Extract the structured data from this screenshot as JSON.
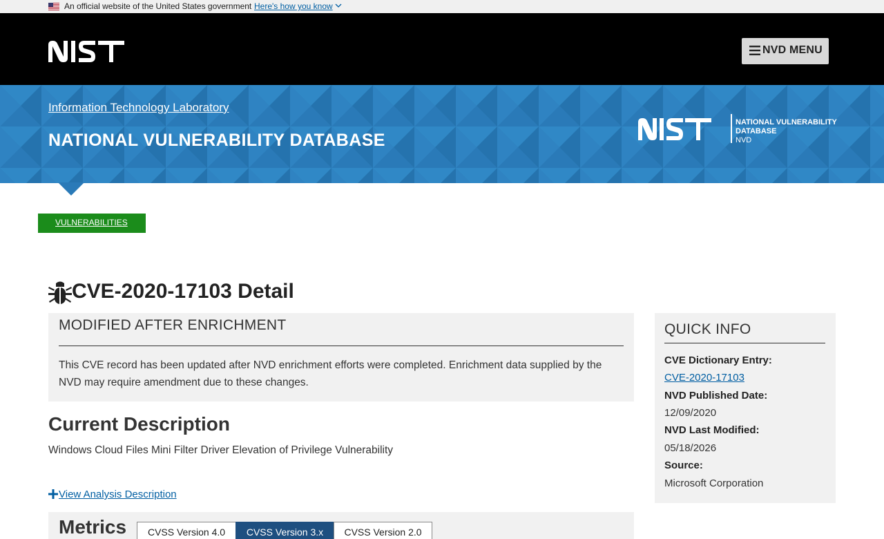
{
  "gov_banner": {
    "text": "An official website of the United States government",
    "link": "Here's how you know"
  },
  "header": {
    "logo_alt": "NIST",
    "menu_label": "NVD MENU"
  },
  "band": {
    "itl_link": "Information Technology Laboratory",
    "title": "NATIONAL VULNERABILITY DATABASE",
    "logo_text": {
      "nist": "NIST",
      "line1": "NATIONAL VULNERABILITY",
      "line2": "DATABASE",
      "line3": "NVD"
    }
  },
  "breadcrumb": {
    "label": "VULNERABILITIES"
  },
  "page": {
    "title": "CVE-2020-17103 Detail"
  },
  "modified": {
    "heading": "MODIFIED AFTER ENRICHMENT",
    "text": "This CVE record has been updated after NVD enrichment efforts were completed. Enrichment data supplied by the NVD may require amendment due to these changes."
  },
  "description": {
    "heading": "Current Description",
    "text": "Windows Cloud Files Mini Filter Driver Elevation of Privilege Vulnerability",
    "analysis_link": "View Analysis Description"
  },
  "metrics": {
    "heading": "Metrics",
    "tabs": [
      "CVSS Version 4.0",
      "CVSS Version 3.x",
      "CVSS Version 2.0"
    ],
    "selected_tab": "CVSS Version 3.x"
  },
  "quick_info": {
    "heading": "QUICK INFO",
    "entries": [
      {
        "label": "CVE Dictionary Entry:",
        "value": "CVE-2020-17103"
      },
      {
        "label": "NVD Published Date:",
        "value": "12/09/2020"
      },
      {
        "label": "NVD Last Modified:",
        "value": "05/18/2026"
      },
      {
        "label": "Source:",
        "value": "Microsoft Corporation"
      }
    ]
  },
  "colors": {
    "band_blue": "#2a7ab8",
    "breadcrumb_green": "#1b8c1b",
    "link_blue": "#005ea2",
    "active_tab": "#1e4f80"
  },
  "icons": [
    "us-flag-icon",
    "chevron-down-icon",
    "hamburger-icon",
    "bug-icon",
    "plus-icon"
  ]
}
